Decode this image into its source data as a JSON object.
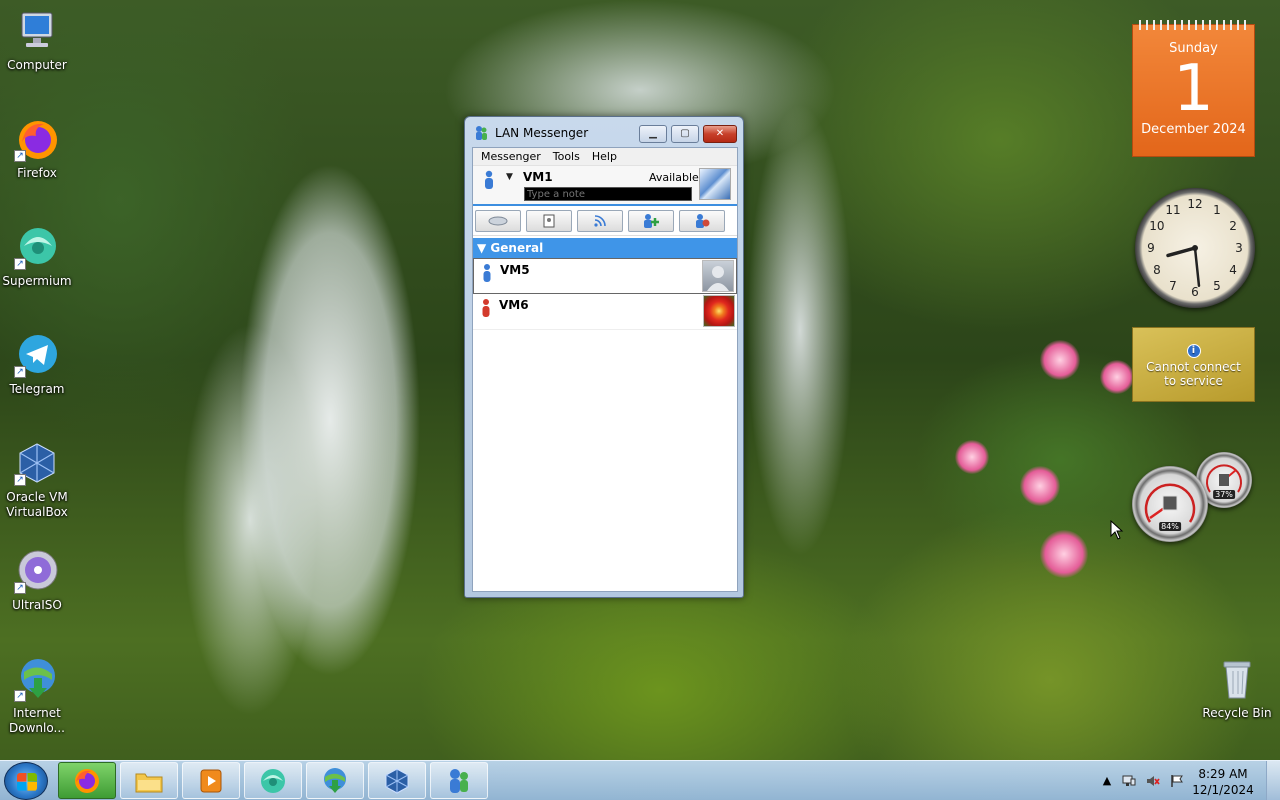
{
  "desktop": {
    "icons": [
      {
        "label": "Computer",
        "icon": "computer-icon"
      },
      {
        "label": "Firefox",
        "icon": "firefox-icon"
      },
      {
        "label": "Supermium",
        "icon": "supermium-icon"
      },
      {
        "label": "Telegram",
        "icon": "telegram-icon"
      },
      {
        "label": "Oracle VM VirtualBox",
        "icon": "virtualbox-icon"
      },
      {
        "label": "UltraISO",
        "icon": "ultraiso-icon"
      },
      {
        "label": "Internet Downlo...",
        "icon": "internet-download-manager-icon"
      },
      {
        "label": "Recycle Bin",
        "icon": "recycle-bin-icon"
      }
    ]
  },
  "gadgets": {
    "calendar": {
      "weekday": "Sunday",
      "day": "1",
      "month_year": "December 2024"
    },
    "clock": {
      "hour": 8,
      "minute": 29
    },
    "weather": {
      "message_line1": "Cannot connect",
      "message_line2": "to service",
      "info_glyph": "i"
    },
    "cpu_meter": {
      "cpu_percent": "84%",
      "memory_percent": "37%"
    }
  },
  "messenger": {
    "title": "LAN Messenger",
    "menu": [
      "Messenger",
      "Tools",
      "Help"
    ],
    "user": {
      "name": "VM1",
      "status": "Available"
    },
    "note_placeholder": "Type a note",
    "toolbar_icons": [
      "broadcast-icon",
      "file-transfer-icon",
      "rss-icon",
      "add-contact-icon",
      "settings-icon"
    ],
    "group": {
      "name": "General"
    },
    "contacts": [
      {
        "name": "VM5",
        "status_color": "#3a7bd5",
        "avatar": "person-avatar"
      },
      {
        "name": "VM6",
        "status_color": "#d33a2c",
        "avatar": "flower-avatar"
      }
    ],
    "caption_buttons": {
      "minimize": "▁",
      "maximize": "▢",
      "close": "✕"
    }
  },
  "taskbar": {
    "pinned": [
      "firefox-icon",
      "file-explorer-icon",
      "media-player-icon",
      "supermium-icon",
      "internet-download-manager-icon",
      "virtualbox-icon",
      "lan-messenger-icon"
    ],
    "time": "8:29 AM",
    "date": "12/1/2024"
  },
  "colors": {
    "accent": "#3f95e8",
    "calendar_orange": "#e8711f",
    "close_red": "#c7402a"
  }
}
